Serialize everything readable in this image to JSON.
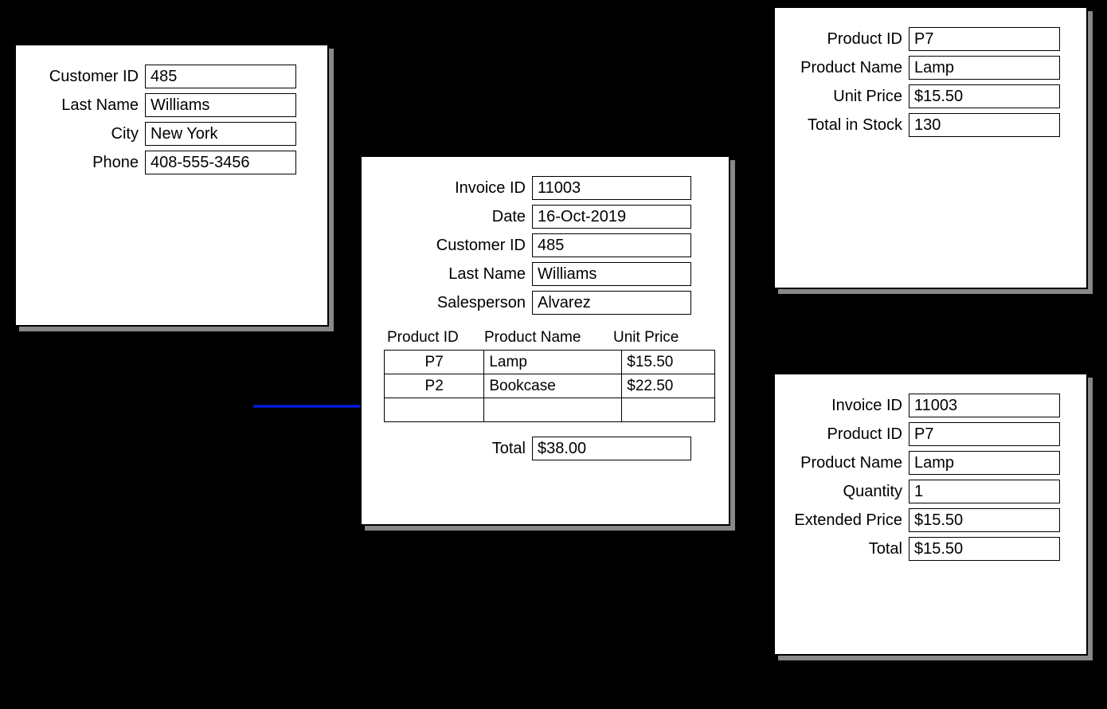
{
  "customer": {
    "labels": {
      "id": "Customer ID",
      "last": "Last Name",
      "city": "City",
      "phone": "Phone"
    },
    "id": "485",
    "last_name": "Williams",
    "city": "New York",
    "phone": "408-555-3456"
  },
  "product": {
    "labels": {
      "id": "Product ID",
      "name": "Product Name",
      "price": "Unit Price",
      "stock": "Total in Stock"
    },
    "id": "P7",
    "name": "Lamp",
    "unit_price": "$15.50",
    "total_in_stock": "130"
  },
  "invoice": {
    "labels": {
      "id": "Invoice ID",
      "date": "Date",
      "cust": "Customer ID",
      "last": "Last Name",
      "sales": "Salesperson",
      "total": "Total"
    },
    "id": "11003",
    "date": "16-Oct-2019",
    "customer_id": "485",
    "last_name": "Williams",
    "salesperson": "Alvarez",
    "columns": {
      "pid": "Product ID",
      "pname": "Product Name",
      "up": "Unit Price"
    },
    "lines": [
      {
        "pid": "P7",
        "pname": "Lamp",
        "up": "$15.50"
      },
      {
        "pid": "P2",
        "pname": "Bookcase",
        "up": "$22.50"
      },
      {
        "pid": "",
        "pname": "",
        "up": ""
      }
    ],
    "total": "$38.00"
  },
  "lineitem": {
    "labels": {
      "inv": "Invoice ID",
      "pid": "Product ID",
      "pname": "Product Name",
      "qty": "Quantity",
      "ext": "Extended Price",
      "total": "Total"
    },
    "invoice_id": "11003",
    "product_id": "P7",
    "product_name": "Lamp",
    "quantity": "1",
    "extended_price": "$15.50",
    "total": "$15.50"
  }
}
